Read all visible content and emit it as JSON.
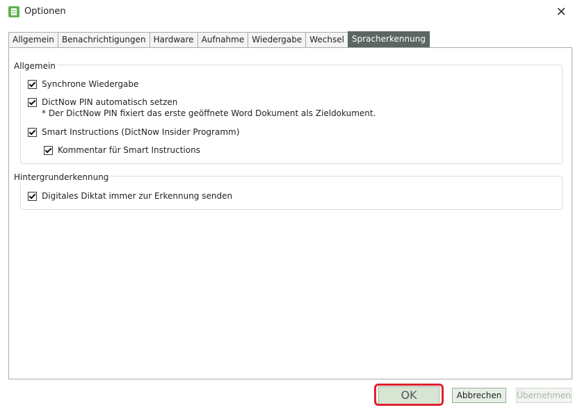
{
  "window": {
    "title": "Optionen",
    "icon": "app-document-icon",
    "close_label": "✕"
  },
  "tabs": [
    {
      "label": "Allgemein",
      "active": false
    },
    {
      "label": "Benachrichtigungen",
      "active": false
    },
    {
      "label": "Hardware",
      "active": false
    },
    {
      "label": "Aufnahme",
      "active": false
    },
    {
      "label": "Wiedergabe",
      "active": false
    },
    {
      "label": "Wechsel",
      "active": false
    },
    {
      "label": "Spracherkennung",
      "active": true
    }
  ],
  "groups": {
    "general": {
      "header": "Allgemein",
      "options": {
        "sync_playback": {
          "label": "Synchrone Wiedergabe",
          "checked": true
        },
        "dictnow_pin": {
          "label": "DictNow PIN automatisch setzen",
          "checked": true
        },
        "dictnow_pin_note": "* Der DictNow PIN fixiert das erste geöffnete Word Dokument als Zieldokument.",
        "smart_instructions": {
          "label": "Smart Instructions (DictNow Insider Programm)",
          "checked": true
        },
        "smart_comment": {
          "label": "Kommentar für Smart Instructions",
          "checked": true
        }
      }
    },
    "background": {
      "header": "Hintergrunderkennung",
      "options": {
        "always_send": {
          "label": "Digitales Diktat immer zur Erkennung senden",
          "checked": true
        }
      }
    }
  },
  "buttons": {
    "ok": "OK",
    "cancel": "Abbrechen",
    "apply": "Übernehmen"
  },
  "colors": {
    "active_tab": "#5b6664",
    "highlight": "#e0202c",
    "button_fill": "#e6efe5"
  }
}
